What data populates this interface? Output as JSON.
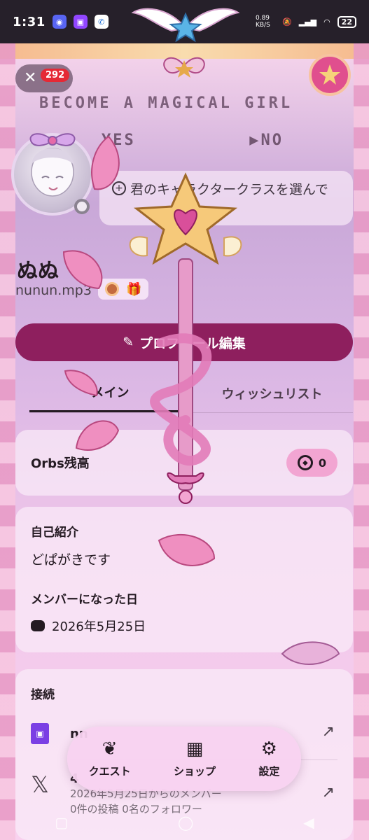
{
  "status_bar": {
    "time": "1:31",
    "network_speed": "0.89 KB/S",
    "battery": "22",
    "icons": [
      "discord-icon",
      "twitch-icon",
      "phone-icon",
      "mute-icon",
      "signal-icon",
      "wifi-icon"
    ]
  },
  "overlay": {
    "notification_count": "292",
    "banner_text": "BECOME A MAGICAL GIRL",
    "yes_option": "YES",
    "no_option": "▶NO"
  },
  "profile": {
    "status_text": "君のキャラクタークラスを選んで",
    "display_name": "ぬぬ",
    "username": "nunun.mp3",
    "edit_button": "プロフィール編集"
  },
  "tabs": [
    {
      "label": "メイン",
      "active": true
    },
    {
      "label": "ウィッシュリスト",
      "active": false
    }
  ],
  "orbs": {
    "label": "Orbs残高",
    "value": "0"
  },
  "about": {
    "title": "自己紹介",
    "text": "どぱがきです",
    "member_title": "メンバーになった日",
    "member_date": "2026年5月25日"
  },
  "connections": {
    "title": "接続",
    "items": [
      {
        "service": "twitch",
        "name": "nn"
      },
      {
        "service": "x",
        "name": "4",
        "member_since": "2026年5月25日からのメンバー",
        "stats": "0件の投稿 0名のフォロワー"
      }
    ]
  },
  "bottom_nav": [
    {
      "label": "クエスト",
      "icon": "laurel-icon"
    },
    {
      "label": "ショップ",
      "icon": "shop-icon"
    },
    {
      "label": "設定",
      "icon": "gear-icon"
    }
  ],
  "colors": {
    "accent": "#8e1f5e",
    "orbs_pill": "#f2a5d2",
    "badge": "#e52935"
  }
}
